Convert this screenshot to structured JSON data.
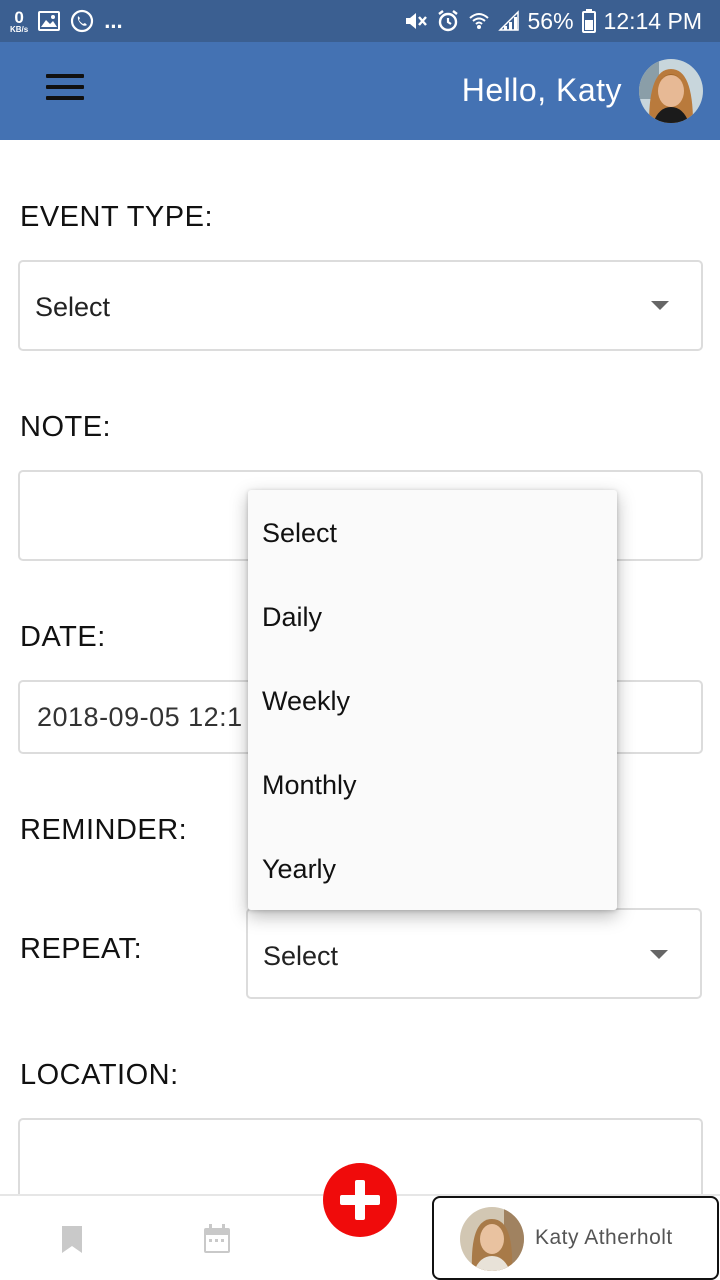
{
  "status_bar": {
    "kbs_value": "0",
    "kbs_unit": "KB/s",
    "more": "...",
    "battery": "56%",
    "time": "12:14 PM"
  },
  "header": {
    "greeting": "Hello, Katy"
  },
  "form": {
    "event_type": {
      "label": "EVENT TYPE:",
      "value": "Select"
    },
    "note": {
      "label": "NOTE:",
      "value": ""
    },
    "date": {
      "label": "DATE:",
      "value": "2018-09-05 12:1"
    },
    "reminder": {
      "label": "REMINDER:"
    },
    "repeat": {
      "label": "REPEAT:",
      "value": "Select"
    },
    "location": {
      "label": "LOCATION:",
      "value": ""
    }
  },
  "dropdown": {
    "options": [
      "Select",
      "Daily",
      "Weekly",
      "Monthly",
      "Yearly"
    ]
  },
  "bottom_nav": {
    "profile_name": "Katy Atherholt"
  },
  "colors": {
    "status_bar": "#3b5f91",
    "header": "#4472b3",
    "fab": "#f00b0b"
  },
  "icons": [
    "data-speed-icon",
    "gallery-icon",
    "whatsapp-icon",
    "mute-icon",
    "alarm-icon",
    "wifi-icon",
    "signal-icon",
    "battery-icon",
    "menu-icon",
    "bookmark-icon",
    "calendar-icon",
    "plus-icon"
  ]
}
